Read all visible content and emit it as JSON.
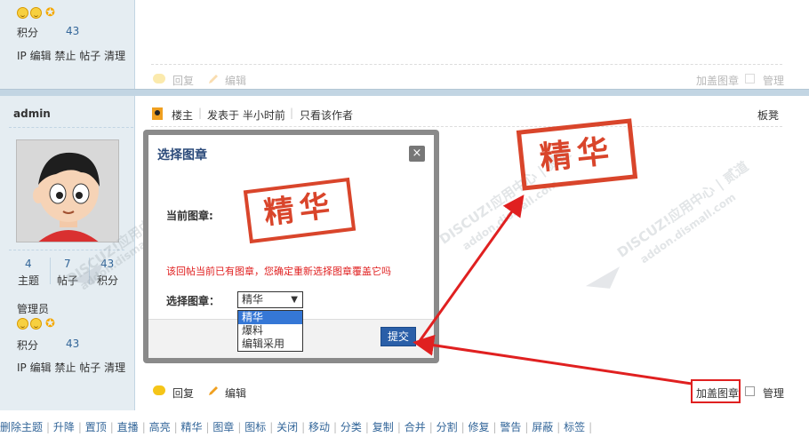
{
  "prev_post": {
    "points_label": "积分",
    "points_value": "43",
    "actions": [
      "IP",
      "编辑",
      "禁止",
      "帖子",
      "清理"
    ],
    "reply_label": "回复",
    "edit_label": "编辑",
    "add_stamp_label": "加盖图章",
    "manage_label": "管理"
  },
  "post": {
    "author": "admin",
    "floor_label": "楼主",
    "posted_label": "发表于 半小时前",
    "only_author_label": "只看该作者",
    "bench_label": "板凳",
    "stats": [
      {
        "value": "4",
        "label": "主题"
      },
      {
        "value": "7",
        "label": "帖子"
      },
      {
        "value": "43",
        "label": "积分"
      }
    ],
    "group": "管理员",
    "points_label": "积分",
    "points_value": "43",
    "actions": [
      "IP",
      "编辑",
      "禁止",
      "帖子",
      "清理"
    ],
    "reply_label": "回复",
    "edit_label": "编辑",
    "add_stamp_label": "加盖图章",
    "manage_label": "管理"
  },
  "stamp_on_post": "精华",
  "dialog": {
    "title": "选择图章",
    "close_label": "×",
    "current_label": "当前图章:",
    "current_stamp": "精华",
    "warning": "该回帖当前已有图章，您确定重新选择图章覆盖它吗",
    "select_label": "选择图章：",
    "select_value": "精华",
    "options": [
      "精华",
      "爆料",
      "编辑采用"
    ],
    "selected_index": 0,
    "submit_label": "提交"
  },
  "watermark": {
    "text1": "DISCUZ!应用中心 | 贰道",
    "text2": "addon.dismall.com"
  },
  "bottom_actions": [
    "删除主题",
    "升降",
    "置顶",
    "直播",
    "高亮",
    "精华",
    "图章",
    "图标",
    "关闭",
    "移动",
    "分类",
    "复制",
    "合并",
    "分割",
    "修复",
    "警告",
    "屏蔽",
    "标签"
  ],
  "colors": {
    "link": "#336699",
    "stamp": "#d9452b",
    "arrow": "#e02020",
    "sidebar": "#e5edf2",
    "submit": "#2a5fa8"
  }
}
